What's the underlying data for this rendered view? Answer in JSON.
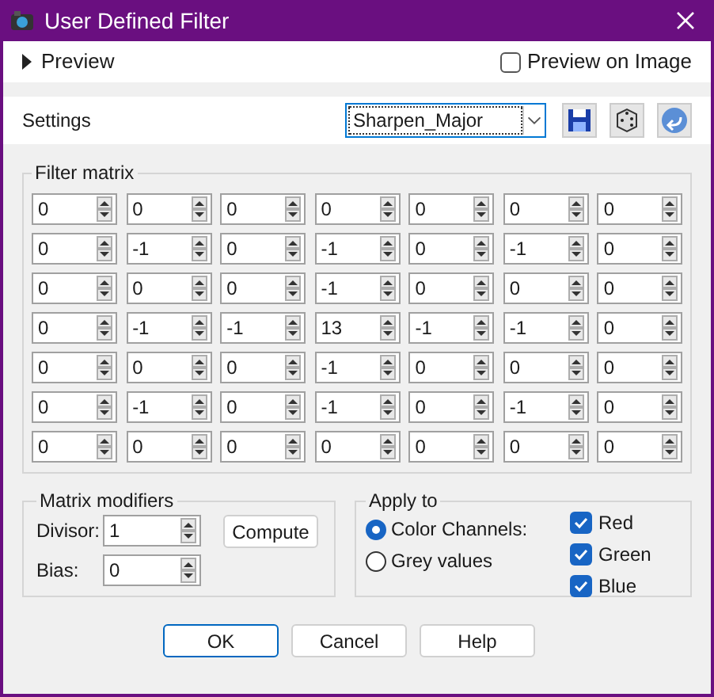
{
  "window": {
    "title": "User Defined Filter"
  },
  "preview": {
    "label": "Preview",
    "expanded": false
  },
  "preview_on_image": {
    "label": "Preview on Image",
    "checked": false
  },
  "settings": {
    "label": "Settings",
    "value": "Sharpen_Major"
  },
  "filter_matrix": {
    "title": "Filter matrix",
    "rows": [
      [
        "0",
        "0",
        "0",
        "0",
        "0",
        "0",
        "0"
      ],
      [
        "0",
        "-1",
        "0",
        "-1",
        "0",
        "-1",
        "0"
      ],
      [
        "0",
        "0",
        "0",
        "-1",
        "0",
        "0",
        "0"
      ],
      [
        "0",
        "-1",
        "-1",
        "13",
        "-1",
        "-1",
        "0"
      ],
      [
        "0",
        "0",
        "0",
        "-1",
        "0",
        "0",
        "0"
      ],
      [
        "0",
        "-1",
        "0",
        "-1",
        "0",
        "-1",
        "0"
      ],
      [
        "0",
        "0",
        "0",
        "0",
        "0",
        "0",
        "0"
      ]
    ]
  },
  "matrix_modifiers": {
    "title": "Matrix modifiers",
    "divisor": {
      "label": "Divisor:",
      "value": "1"
    },
    "bias": {
      "label": "Bias:",
      "value": "0"
    },
    "compute": "Compute"
  },
  "apply_to": {
    "title": "Apply to",
    "options": [
      {
        "label": "Color Channels:",
        "selected": true
      },
      {
        "label": "Grey values",
        "selected": false
      }
    ],
    "channels": [
      {
        "label": "Red",
        "checked": true
      },
      {
        "label": "Green",
        "checked": true
      },
      {
        "label": "Blue",
        "checked": true
      }
    ]
  },
  "buttons": [
    {
      "label": "OK",
      "default": true
    },
    {
      "label": "Cancel",
      "default": false
    },
    {
      "label": "Help",
      "default": false
    }
  ]
}
